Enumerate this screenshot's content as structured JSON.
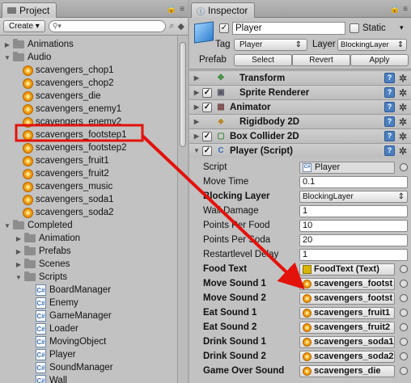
{
  "project": {
    "tab_label": "Project",
    "create_label": "Create",
    "items": [
      {
        "label": "Animations",
        "kind": "folder",
        "depth": 0,
        "expanded": false
      },
      {
        "label": "Audio",
        "kind": "folder",
        "depth": 0,
        "expanded": true
      },
      {
        "label": "scavengers_chop1",
        "kind": "audio",
        "depth": 1
      },
      {
        "label": "scavengers_chop2",
        "kind": "audio",
        "depth": 1
      },
      {
        "label": "scavengers_die",
        "kind": "audio",
        "depth": 1
      },
      {
        "label": "scavengers_enemy1",
        "kind": "audio",
        "depth": 1
      },
      {
        "label": "scavengers_enemy2",
        "kind": "audio",
        "depth": 1
      },
      {
        "label": "scavengers_footstep1",
        "kind": "audio",
        "depth": 1,
        "highlighted": true
      },
      {
        "label": "scavengers_footstep2",
        "kind": "audio",
        "depth": 1
      },
      {
        "label": "scavengers_fruit1",
        "kind": "audio",
        "depth": 1
      },
      {
        "label": "scavengers_fruit2",
        "kind": "audio",
        "depth": 1
      },
      {
        "label": "scavengers_music",
        "kind": "audio",
        "depth": 1
      },
      {
        "label": "scavengers_soda1",
        "kind": "audio",
        "depth": 1
      },
      {
        "label": "scavengers_soda2",
        "kind": "audio",
        "depth": 1
      },
      {
        "label": "Completed",
        "kind": "folder",
        "depth": 0,
        "expanded": true
      },
      {
        "label": "Animation",
        "kind": "folder",
        "depth": 1,
        "expanded": false
      },
      {
        "label": "Prefabs",
        "kind": "folder",
        "depth": 1,
        "expanded": false
      },
      {
        "label": "Scenes",
        "kind": "folder",
        "depth": 1,
        "expanded": false
      },
      {
        "label": "Scripts",
        "kind": "folder",
        "depth": 1,
        "expanded": true
      },
      {
        "label": "BoardManager",
        "kind": "script",
        "depth": 2
      },
      {
        "label": "Enemy",
        "kind": "script",
        "depth": 2
      },
      {
        "label": "GameManager",
        "kind": "script",
        "depth": 2
      },
      {
        "label": "Loader",
        "kind": "script",
        "depth": 2
      },
      {
        "label": "MovingObject",
        "kind": "script",
        "depth": 2
      },
      {
        "label": "Player",
        "kind": "script",
        "depth": 2
      },
      {
        "label": "SoundManager",
        "kind": "script",
        "depth": 2
      },
      {
        "label": "Wall",
        "kind": "script",
        "depth": 2
      }
    ]
  },
  "inspector": {
    "tab_label": "Inspector",
    "object_name": "Player",
    "static_label": "Static",
    "tag_label": "Tag",
    "tag_value": "Player",
    "layer_label": "Layer",
    "layer_value": "BlockingLayer",
    "prefab_label": "Prefab",
    "prefab_buttons": [
      "Select",
      "Revert",
      "Apply"
    ],
    "components": [
      "Transform",
      "Sprite Renderer",
      "Animator",
      "Rigidbody 2D",
      "Box Collider 2D",
      "Player (Script)"
    ],
    "script_label": "Script",
    "script_value": "Player",
    "fields": [
      {
        "label": "Move Time",
        "value": "0.1",
        "bold": false,
        "type": "text"
      },
      {
        "label": "Blocking Layer",
        "value": "BlockingLayer",
        "bold": true,
        "type": "dropdown"
      },
      {
        "label": "Wall Damage",
        "value": "1",
        "bold": false,
        "type": "text"
      },
      {
        "label": "Points Per Food",
        "value": "10",
        "bold": false,
        "type": "text"
      },
      {
        "label": "Points Per Soda",
        "value": "20",
        "bold": false,
        "type": "text"
      },
      {
        "label": "Restartlevel Delay",
        "value": "1",
        "bold": false,
        "type": "text"
      },
      {
        "label": "Food Text",
        "value": "FoodText (Text)",
        "bold": true,
        "type": "object",
        "icon": "text"
      },
      {
        "label": "Move Sound 1",
        "value": "scavengers_footst",
        "bold": true,
        "type": "object",
        "icon": "audio"
      },
      {
        "label": "Move Sound 2",
        "value": "scavengers_footst",
        "bold": true,
        "type": "object",
        "icon": "audio"
      },
      {
        "label": "Eat Sound 1",
        "value": "scavengers_fruit1",
        "bold": true,
        "type": "object",
        "icon": "audio"
      },
      {
        "label": "Eat Sound 2",
        "value": "scavengers_fruit2",
        "bold": true,
        "type": "object",
        "icon": "audio"
      },
      {
        "label": "Drink Sound 1",
        "value": "scavengers_soda1",
        "bold": true,
        "type": "object",
        "icon": "audio"
      },
      {
        "label": "Drink Sound 2",
        "value": "scavengers_soda2",
        "bold": true,
        "type": "object",
        "icon": "audio"
      },
      {
        "label": "Game Over Sound",
        "value": "scavengers_die",
        "bold": true,
        "type": "object",
        "icon": "audio"
      }
    ]
  },
  "annotation": {
    "arrow_color": "#e3120b"
  }
}
